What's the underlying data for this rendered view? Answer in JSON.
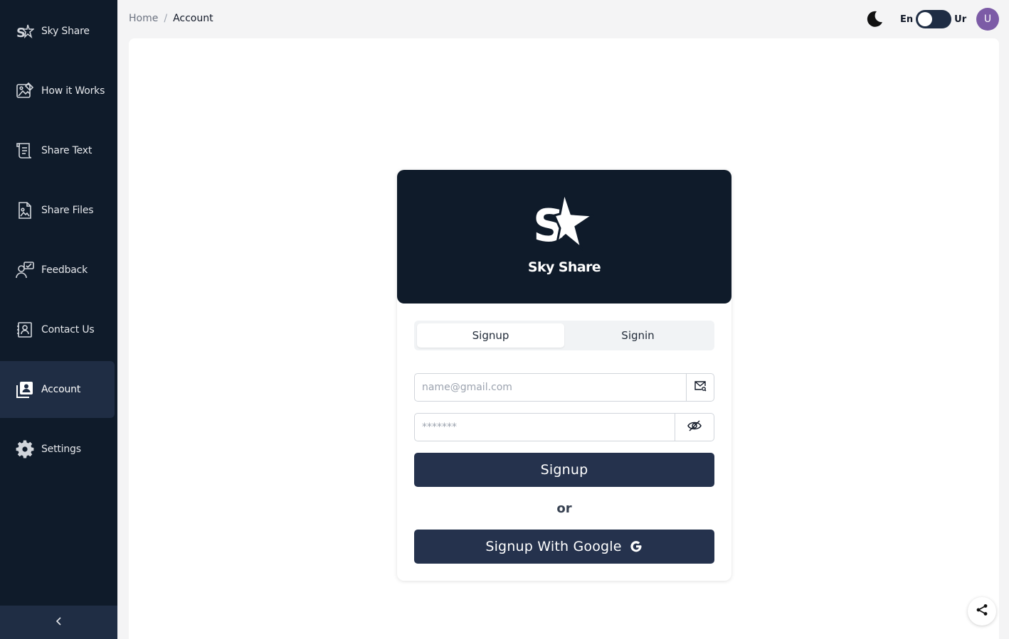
{
  "app": {
    "brand": "Sky Share"
  },
  "sidebar": {
    "items": [
      {
        "label": "Sky Share",
        "icon": "logo-icon"
      },
      {
        "label": "How it Works",
        "icon": "image-edit-icon"
      },
      {
        "label": "Share Text",
        "icon": "scroll-text-icon"
      },
      {
        "label": "Share Files",
        "icon": "file-image-icon"
      },
      {
        "label": "Feedback",
        "icon": "user-chat-icon"
      },
      {
        "label": "Contact Us",
        "icon": "contact-book-icon"
      },
      {
        "label": "Account",
        "icon": "account-box-icon",
        "active": true
      },
      {
        "label": "Settings",
        "icon": "gear-icon"
      }
    ],
    "collapse_icon": "chevron-left-icon"
  },
  "breadcrumb": {
    "home": "Home",
    "separator": "/",
    "current": "Account"
  },
  "topbar": {
    "theme_icon": "moon-icon",
    "lang_left": "En",
    "lang_right": "Ur",
    "avatar_initial": "U"
  },
  "auth": {
    "brand": "Sky Share",
    "tabs": [
      {
        "label": "Signup",
        "active": true
      },
      {
        "label": "Signin",
        "active": false
      }
    ],
    "email": {
      "placeholder": "name@gmail.com",
      "value": ""
    },
    "password": {
      "placeholder": "*******",
      "value": ""
    },
    "submit_label": "Signup",
    "or_label": "or",
    "google_label": "Signup With Google"
  },
  "colors": {
    "sidebar_bg": "#0f1b2a",
    "active_bg": "#1f2d44",
    "button_bg": "#25324d",
    "avatar_bg": "#7c5ba6"
  }
}
